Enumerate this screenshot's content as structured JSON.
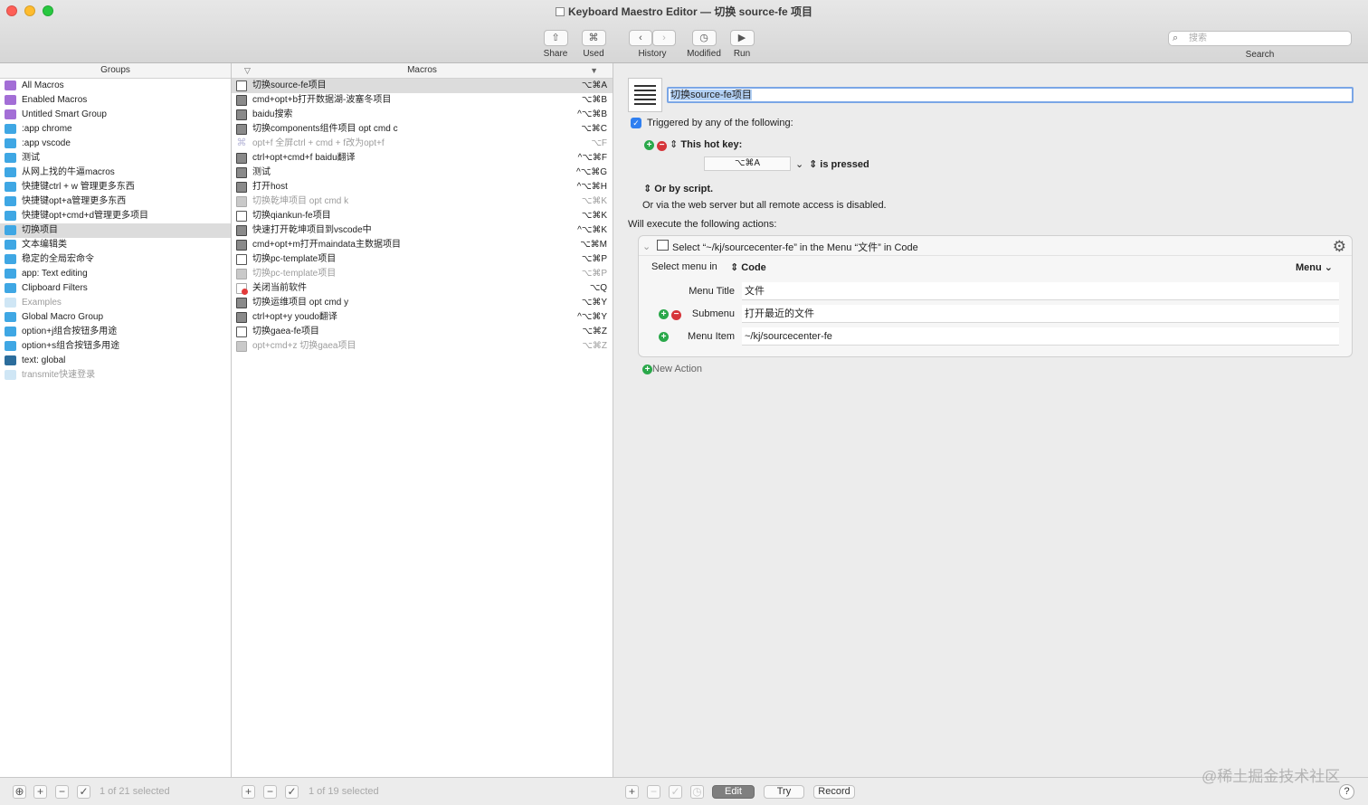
{
  "window": {
    "title": "Keyboard Maestro Editor — 切换 source-fe 项目",
    "traffic_colors": [
      "#fe5f57",
      "#febc2e",
      "#28c840"
    ]
  },
  "toolbar": {
    "share": {
      "label": "Share",
      "icon": "share-icon"
    },
    "used": {
      "label": "Used",
      "icon": "⌘"
    },
    "history": {
      "label": "History",
      "back_icon": "chevron-left-icon",
      "forward_icon": "chevron-right-icon"
    },
    "modified": {
      "label": "Modified",
      "icon": "clock-icon"
    },
    "run": {
      "label": "Run",
      "icon": "play-icon"
    },
    "search": {
      "placeholder": "搜索",
      "label": "Search"
    }
  },
  "groups": {
    "header": "Groups",
    "items": [
      {
        "label": "All Macros",
        "icon": "folder-purple",
        "dim": false
      },
      {
        "label": "Enabled Macros",
        "icon": "folder-purple",
        "dim": false
      },
      {
        "label": "Untitled Smart Group",
        "icon": "folder-purple",
        "dim": false
      },
      {
        "label": ":app chrome",
        "icon": "folder-blue",
        "dim": false
      },
      {
        "label": ":app vscode",
        "icon": "folder-blue",
        "dim": false
      },
      {
        "label": "测试",
        "icon": "folder-blue",
        "dim": false
      },
      {
        "label": "从网上找的牛逼macros",
        "icon": "folder-blue",
        "dim": false
      },
      {
        "label": "快捷键ctrl + w 管理更多东西",
        "icon": "folder-blue",
        "dim": false
      },
      {
        "label": "快捷键opt+a管理更多东西",
        "icon": "folder-blue",
        "dim": false
      },
      {
        "label": "快捷键opt+cmd+d管理更多项目",
        "icon": "folder-blue",
        "dim": false
      },
      {
        "label": "切换项目",
        "icon": "folder-blue",
        "dim": false,
        "selected": true
      },
      {
        "label": "文本编辑类",
        "icon": "folder-blue",
        "dim": false
      },
      {
        "label": "稳定的全局宏命令",
        "icon": "folder-blue",
        "dim": false
      },
      {
        "label": "app: Text editing",
        "icon": "folder-blue",
        "dim": false
      },
      {
        "label": "Clipboard Filters",
        "icon": "folder-blue",
        "dim": false
      },
      {
        "label": "Examples",
        "icon": "folder-light",
        "dim": true
      },
      {
        "label": "Global Macro Group",
        "icon": "folder-blue",
        "dim": false
      },
      {
        "label": "option+j组合按钮多用途",
        "icon": "folder-blue",
        "dim": false
      },
      {
        "label": "option+s组合按钮多用途",
        "icon": "folder-blue",
        "dim": false
      },
      {
        "label": "text: global",
        "icon": "folder-dark",
        "dim": false
      },
      {
        "label": "transmite快速登录",
        "icon": "folder-light",
        "dim": true
      }
    ],
    "status": "1 of 21 selected"
  },
  "macros": {
    "header": "Macros",
    "items": [
      {
        "label": "切换source-fe项目",
        "key": "⌥⌘A",
        "icon": "list",
        "dim": false,
        "selected": true
      },
      {
        "label": "cmd+opt+b打开数据湖-波塞冬项目",
        "key": "⌥⌘B",
        "icon": "multi",
        "dim": false
      },
      {
        "label": "baidu搜索",
        "key": "^⌥⌘B",
        "icon": "multi",
        "dim": false
      },
      {
        "label": "切换components组件项目 opt cmd c",
        "key": "⌥⌘C",
        "icon": "multi",
        "dim": false
      },
      {
        "label": "opt+f 全屏ctrl + cmd + f改为opt+f",
        "key": "⌥F",
        "icon": "cmd",
        "dim": true
      },
      {
        "label": "ctrl+opt+cmd+f baidu翻译",
        "key": "^⌥⌘F",
        "icon": "multi",
        "dim": false
      },
      {
        "label": "测试",
        "key": "^⌥⌘G",
        "icon": "multi",
        "dim": false
      },
      {
        "label": "打开host",
        "key": "^⌥⌘H",
        "icon": "multi",
        "dim": false
      },
      {
        "label": "切换乾坤项目 opt cmd k",
        "key": "⌥⌘K",
        "icon": "multi-dim",
        "dim": true
      },
      {
        "label": "切换qiankun-fe项目",
        "key": "⌥⌘K",
        "icon": "list",
        "dim": false
      },
      {
        "label": "快速打开乾坤项目到vscode中",
        "key": "^⌥⌘K",
        "icon": "multi",
        "dim": false
      },
      {
        "label": "cmd+opt+m打开maindata主数据项目",
        "key": "⌥⌘M",
        "icon": "multi",
        "dim": false
      },
      {
        "label": "切换pc-template项目",
        "key": "⌥⌘P",
        "icon": "list",
        "dim": false
      },
      {
        "label": "切换pc-template项目",
        "key": "⌥⌘P",
        "icon": "multi-dim",
        "dim": true
      },
      {
        "label": "关闭当前软件",
        "key": "⌥Q",
        "icon": "quit",
        "dim": false
      },
      {
        "label": "切换运维项目 opt cmd y",
        "key": "⌥⌘Y",
        "icon": "multi",
        "dim": false
      },
      {
        "label": "ctrl+opt+y youdo翻译",
        "key": "^⌥⌘Y",
        "icon": "multi",
        "dim": false
      },
      {
        "label": "切换gaea-fe项目",
        "key": "⌥⌘Z",
        "icon": "list",
        "dim": false
      },
      {
        "label": "opt+cmd+z 切换gaea项目",
        "key": "⌥⌘Z",
        "icon": "multi-dim",
        "dim": true
      }
    ],
    "status": "1 of 19 selected"
  },
  "editor": {
    "macro_name": "切换source-fe项目",
    "triggered_label": "Triggered by any of the following:",
    "hotkey_label": "This hot key:",
    "hotkey_value": "⌥⌘A",
    "is_pressed": "is pressed",
    "or_by_script": "Or by script.",
    "web_server_note": "Or via the web server but all remote access is disabled.",
    "will_execute": "Will execute the following actions:",
    "action": {
      "title": "Select “~/kj/sourcecenter-fe” in the Menu “文件” in Code",
      "select_menu_in": "Select menu in",
      "app": "Code",
      "menu_dropdown": "Menu",
      "menu_title_label": "Menu Title",
      "menu_title_value": "文件",
      "submenu_label": "Submenu",
      "submenu_value": "打开最近的文件",
      "menu_item_label": "Menu Item",
      "menu_item_value": "~/kj/sourcecenter-fe"
    },
    "new_action": "New Action"
  },
  "bottom": {
    "edit": "Edit",
    "try": "Try",
    "record": "Record",
    "help": "?"
  },
  "watermark": "@稀土掘金技术社区"
}
